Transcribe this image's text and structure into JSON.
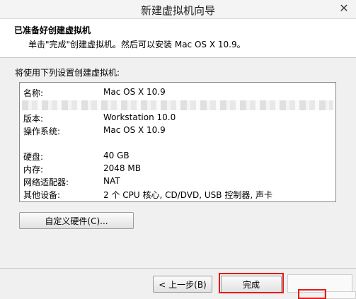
{
  "window": {
    "title": "新建虚拟机向导",
    "close_glyph": "✕"
  },
  "header": {
    "title": "已准备好创建虚拟机",
    "subtitle": "单击\"完成\"创建虚拟机。然后可以安装 Mac OS X 10.9。"
  },
  "summary": {
    "label": "将使用下列设置创建虚拟机:",
    "rows": [
      {
        "key": "名称:",
        "value": "Mac OS X 10.9"
      },
      {
        "key": "版本:",
        "value": "Workstation 10.0"
      },
      {
        "key": "操作系统:",
        "value": "Mac OS X 10.9"
      },
      {
        "key": "硬盘:",
        "value": "40 GB"
      },
      {
        "key": "内存:",
        "value": "2048 MB"
      },
      {
        "key": "网络适配器:",
        "value": "NAT"
      },
      {
        "key": "其他设备:",
        "value": "2 个 CPU 核心, CD/DVD, USB 控制器, 声卡"
      }
    ]
  },
  "buttons": {
    "customize": "自定义硬件(C)...",
    "back": "< 上一步(B)",
    "finish": "完成"
  },
  "colors": {
    "highlight": "#e21b1b"
  }
}
